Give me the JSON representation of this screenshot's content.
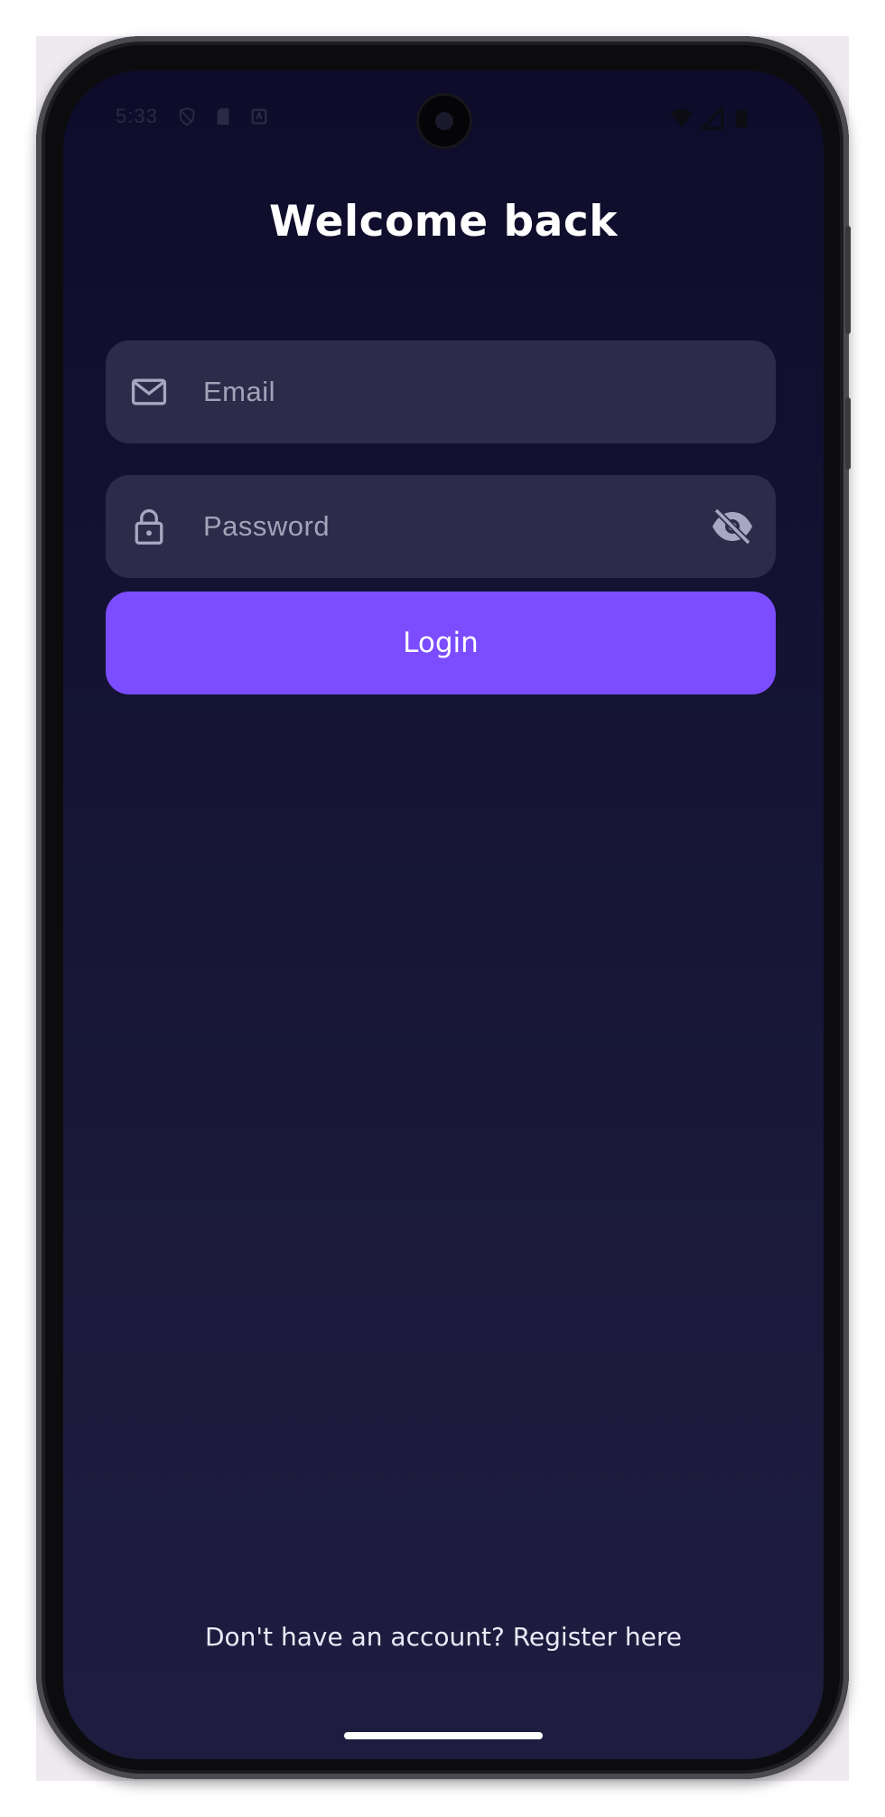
{
  "status_bar": {
    "time": "5:33",
    "left_icons": [
      "shield-icon",
      "sd-card-icon",
      "notification-icon"
    ],
    "right_icons": [
      "wifi-icon",
      "cell-signal-icon",
      "battery-icon"
    ]
  },
  "login": {
    "title": "Welcome back",
    "email": {
      "placeholder": "Email",
      "value": "",
      "icon": "mail-icon"
    },
    "password": {
      "placeholder": "Password",
      "value": "",
      "icon": "lock-icon",
      "toggle_icon": "eye-off-icon"
    },
    "submit_label": "Login",
    "register_prompt": "Don't have an account?",
    "register_link": "Register here"
  },
  "colors": {
    "background_top": "#0e0c2a",
    "background_bottom": "#1e1d40",
    "field_background": "#2d2b4a",
    "accent": "#7c4dff",
    "text": "#ffffff",
    "placeholder": "#a4a2b8"
  }
}
